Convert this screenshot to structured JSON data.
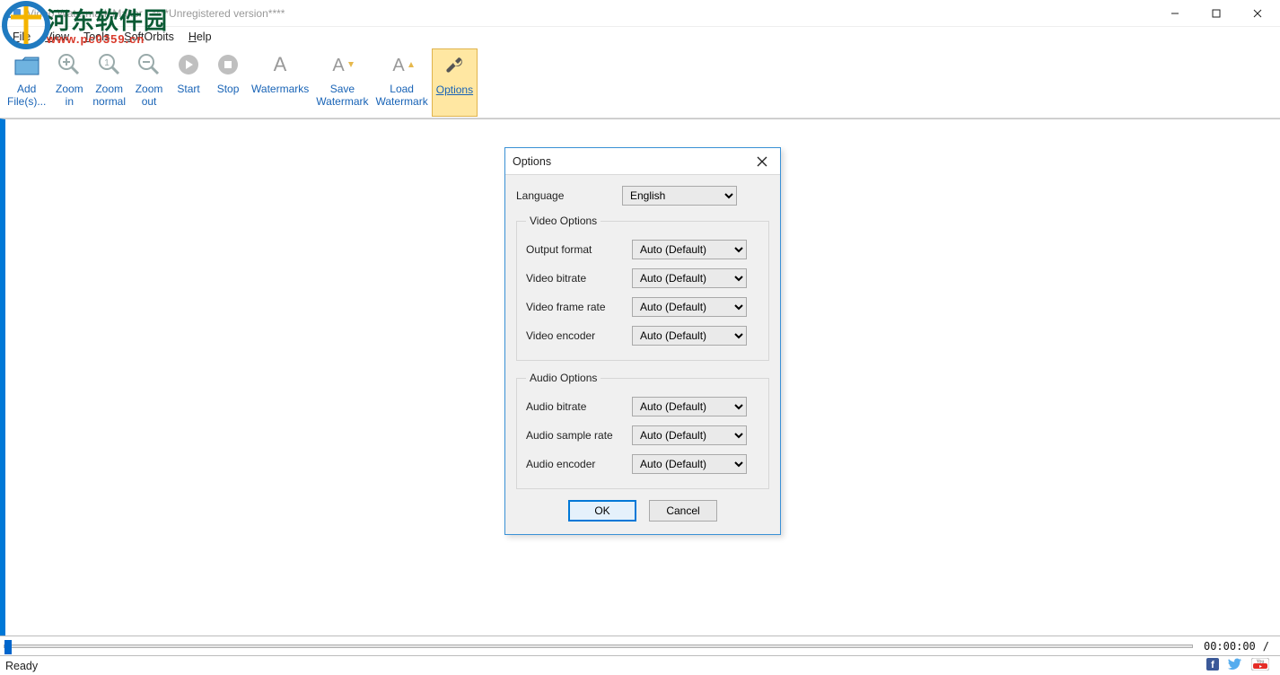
{
  "window": {
    "title": "Video Watermark Maker - ****Unregistered version****"
  },
  "overlay": {
    "site_name_cn": "河东软件园",
    "site_url": "www.pc0359.cn"
  },
  "menu": {
    "items": [
      {
        "pre": "F",
        "rest": "ile"
      },
      {
        "pre": "V",
        "rest": "iew"
      },
      {
        "pre": "T",
        "rest": "ools"
      },
      {
        "pre": "S",
        "rest": "oftOrbits"
      },
      {
        "pre": "H",
        "rest": "elp"
      }
    ]
  },
  "toolbar": [
    {
      "name": "add-files",
      "label": "Add\nFile(s)...",
      "icon": "folder"
    },
    {
      "name": "zoom-in",
      "label": "Zoom\nin",
      "icon": "zoom-in"
    },
    {
      "name": "zoom-normal",
      "label": "Zoom\nnormal",
      "icon": "zoom-1"
    },
    {
      "name": "zoom-out",
      "label": "Zoom\nout",
      "icon": "zoom-out"
    },
    {
      "name": "start",
      "label": "Start",
      "icon": "play"
    },
    {
      "name": "stop",
      "label": "Stop",
      "icon": "stop"
    },
    {
      "name": "watermarks",
      "label": "Watermarks",
      "icon": "A"
    },
    {
      "name": "save-watermark",
      "label": "Save\nWatermark",
      "icon": "A-down"
    },
    {
      "name": "load-watermark",
      "label": "Load\nWatermark",
      "icon": "A-up"
    },
    {
      "name": "options",
      "label": "Options",
      "icon": "wrench",
      "active": true
    }
  ],
  "timeline": {
    "time": "00:00:00",
    "sep": "/"
  },
  "status": {
    "text": "Ready"
  },
  "dialog": {
    "title": "Options",
    "language_label": "Language",
    "language_value": "English",
    "video_group": "Video Options",
    "audio_group": "Audio Options",
    "video_fields": [
      {
        "label": "Output format",
        "value": "Auto (Default)"
      },
      {
        "label": "Video bitrate",
        "value": "Auto (Default)"
      },
      {
        "label": "Video frame rate",
        "value": "Auto (Default)"
      },
      {
        "label": "Video encoder",
        "value": "Auto (Default)"
      }
    ],
    "audio_fields": [
      {
        "label": "Audio bitrate",
        "value": "Auto (Default)"
      },
      {
        "label": "Audio sample rate",
        "value": "Auto (Default)"
      },
      {
        "label": "Audio encoder",
        "value": "Auto (Default)"
      }
    ],
    "ok": "OK",
    "cancel": "Cancel"
  }
}
